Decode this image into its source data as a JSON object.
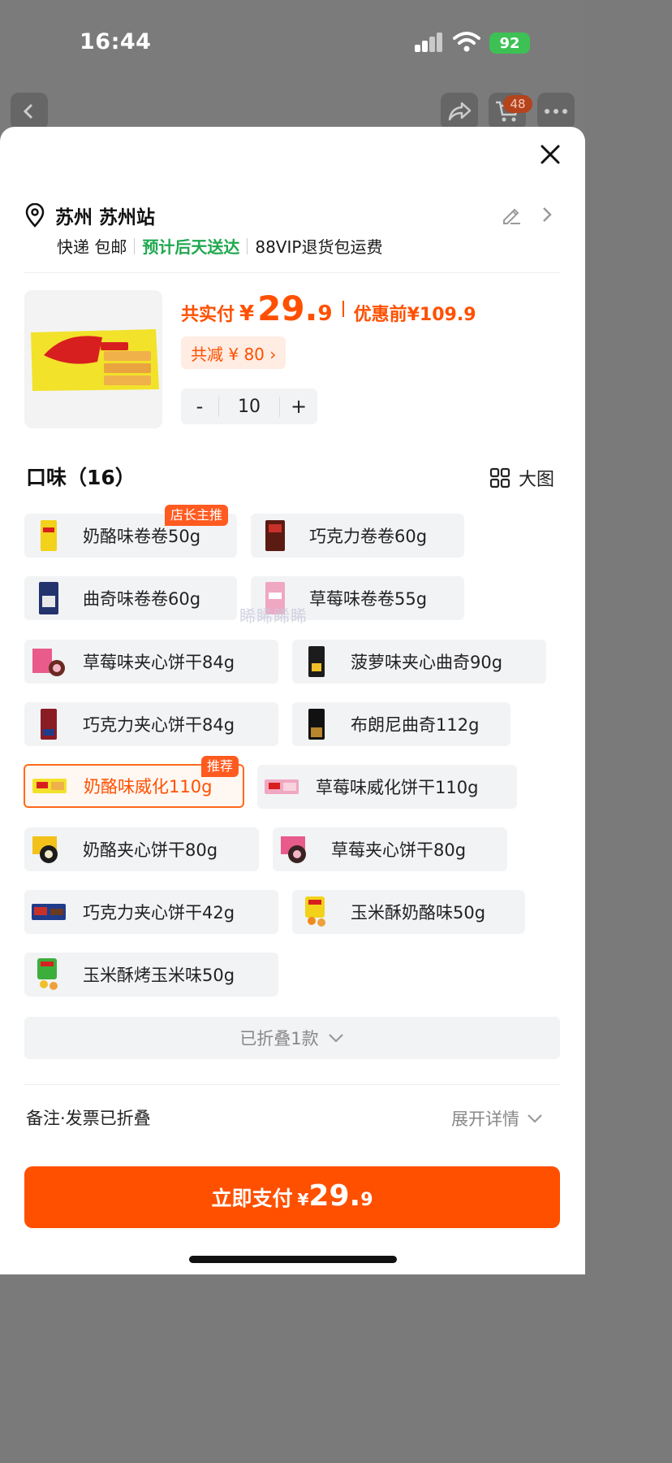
{
  "status_bar": {
    "time": "16:44",
    "battery": "92"
  },
  "background": {
    "cart_badge": "48"
  },
  "address": {
    "text": "苏州 苏州站"
  },
  "shipping": {
    "method": "快递 包邮",
    "eta": "预计后天送达",
    "vip": "88VIP退货包运费"
  },
  "product": {
    "total_label": "共实付",
    "currency": "¥",
    "price_int": "29.",
    "price_dec": "9",
    "before_label": "优惠前",
    "before_price": "¥109.9",
    "discount": "共减 ¥ 80 ›",
    "quantity": "10",
    "minus": "-",
    "plus": "+"
  },
  "flavors": {
    "title": "口味（16）",
    "big_image": "大图",
    "watermark": "睎睎睎睎",
    "items": [
      {
        "label": "奶酪味卷卷50g",
        "tag": "店长主推",
        "selected": false
      },
      {
        "label": "巧克力卷卷60g",
        "selected": false
      },
      {
        "label": "曲奇味卷卷60g",
        "selected": false
      },
      {
        "label": "草莓味卷卷55g",
        "selected": false
      },
      {
        "label": "草莓味夹心饼干84g",
        "selected": false
      },
      {
        "label": "菠萝味夹心曲奇90g",
        "selected": false
      },
      {
        "label": "巧克力夹心饼干84g",
        "selected": false
      },
      {
        "label": "布朗尼曲奇112g",
        "selected": false
      },
      {
        "label": "奶酪味威化110g",
        "tag": "推荐",
        "selected": true
      },
      {
        "label": "草莓味威化饼干110g",
        "selected": false
      },
      {
        "label": "奶酪夹心饼干80g",
        "selected": false
      },
      {
        "label": "草莓夹心饼干80g",
        "selected": false
      },
      {
        "label": "巧克力夹心饼干42g",
        "selected": false
      },
      {
        "label": "玉米酥奶酪味50g",
        "selected": false
      },
      {
        "label": "玉米酥烤玉米味50g",
        "selected": false
      }
    ],
    "folded": "已折叠1款"
  },
  "notes": {
    "label": "备注·发票已折叠",
    "expand": "展开详情"
  },
  "pay": {
    "label": "立即支付",
    "currency": "¥",
    "price_int": "29.",
    "price_dec": "9"
  },
  "colors": {
    "accent": "#ff5000",
    "green": "#1fa84f",
    "chip_bg": "#f2f3f5"
  }
}
